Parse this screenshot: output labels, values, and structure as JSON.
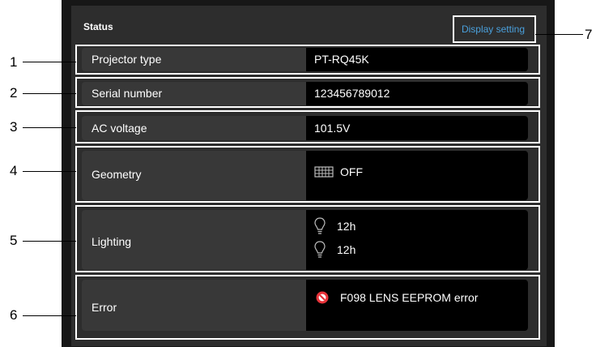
{
  "panel": {
    "title": "Status",
    "display_setting_label": "Display setting"
  },
  "rows": [
    {
      "label": "Projector type",
      "value": "PT-RQ45K"
    },
    {
      "label": "Serial number",
      "value": "123456789012"
    },
    {
      "label": "AC voltage",
      "value": "101.5V"
    },
    {
      "label": "Geometry",
      "value": "OFF",
      "icon": "geometry-grid-icon"
    },
    {
      "label": "Lighting",
      "values": [
        "12h",
        "12h"
      ],
      "icon": "light-bulb-icon"
    },
    {
      "label": "Error",
      "value": "F098 LENS EEPROM error",
      "icon": "error-prohibited-icon"
    }
  ],
  "callouts": [
    "1",
    "2",
    "3",
    "4",
    "5",
    "6",
    "7"
  ],
  "colors": {
    "panel_bg": "#2d2d2d",
    "value_bg": "#000000",
    "link": "#4aa0dc",
    "error_icon": "#e8333a"
  }
}
